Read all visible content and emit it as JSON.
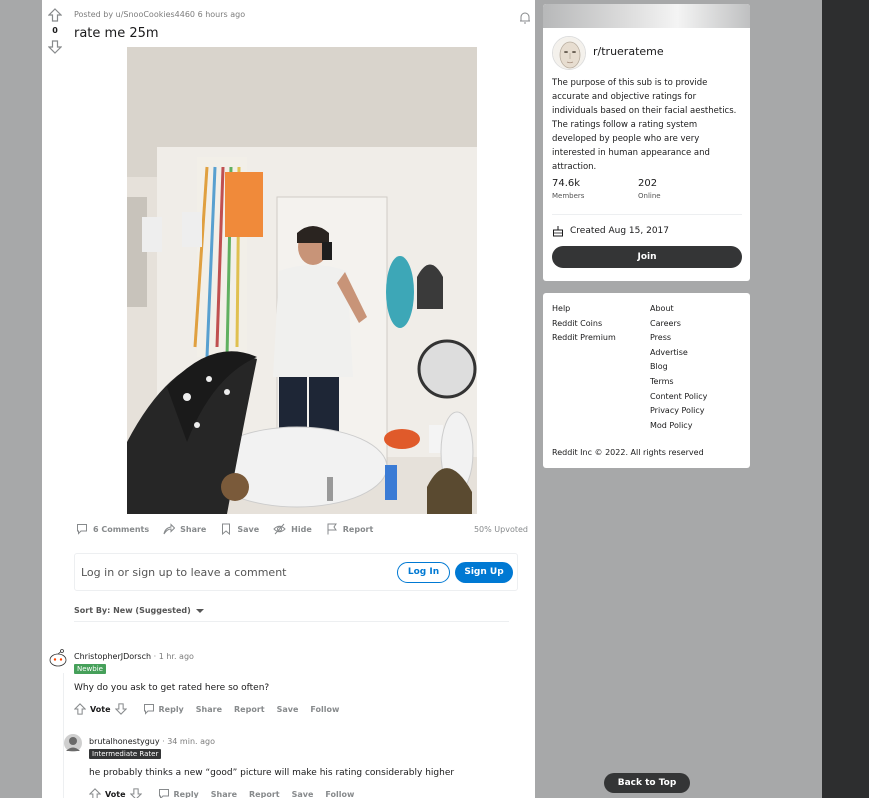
{
  "post": {
    "vote_count": "0",
    "posted_by": "Posted by u/SnooCookies4460 6 hours ago",
    "title": "rate me 25m",
    "actions": {
      "comments": "6 Comments",
      "share": "Share",
      "save": "Save",
      "hide": "Hide",
      "report": "Report"
    },
    "upvoted": "50% Upvoted"
  },
  "comment_box": {
    "prompt": "Log in or sign up to leave a comment",
    "login": "Log In",
    "signup": "Sign Up"
  },
  "sort": {
    "label": "Sort By: New (Suggested)"
  },
  "comments": [
    {
      "author": "ChristopherJDorsch",
      "time": " · 1 hr. ago",
      "flair": "Newbie",
      "text": "Why do you ask to get rated here so often?",
      "actions": [
        "Vote",
        "Reply",
        "Share",
        "Report",
        "Save",
        "Follow"
      ]
    },
    {
      "author": "brutalhonestyguy",
      "time": " · 34 min. ago",
      "flair": "Intermediate Rater",
      "text": "he probably thinks a new “good” picture will make his rating considerably higher",
      "actions": [
        "Vote",
        "Reply",
        "Share",
        "Report",
        "Save",
        "Follow"
      ]
    }
  ],
  "sidebar": {
    "name": "r/truerateme",
    "description": "The purpose of this sub is to provide accurate and objective ratings for individuals based on their facial aesthetics. The ratings follow a rating system developed by people who are very interested in human appearance and attraction.",
    "members_value": "74.6k",
    "members_label": "Members",
    "online_value": "202",
    "online_label": "Online",
    "created": "Created Aug 15, 2017",
    "join": "Join"
  },
  "footer": {
    "left": [
      "Help",
      "Reddit Coins",
      "Reddit Premium"
    ],
    "right": [
      "About",
      "Careers",
      "Press",
      "Advertise",
      "Blog",
      "Terms",
      "Content Policy",
      "Privacy Policy",
      "Mod Policy"
    ],
    "copyright": "Reddit Inc © 2022. All rights reserved"
  },
  "back_to_top": "Back to Top",
  "colors": {
    "accent": "#0079d3",
    "dark_button": "#343536",
    "newbie_flair": "#46a05a",
    "rater_flair": "#343536"
  }
}
